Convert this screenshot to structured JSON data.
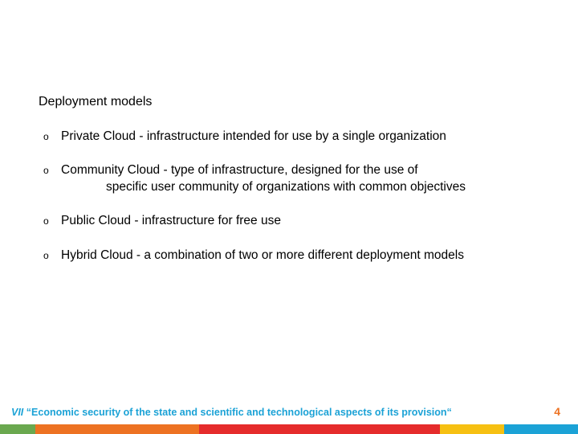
{
  "heading": "Deployment models",
  "bullets": [
    {
      "line1": "Private Cloud - infrastructure intended for use by a single organization",
      "line2": ""
    },
    {
      "line1": "Community Cloud - type of infrastructure, designed for the use of",
      "line2": "specific user community of organizations with common objectives"
    },
    {
      "line1": "Public Cloud - infrastructure for free use",
      "line2": ""
    },
    {
      "line1": "Hybrid Cloud - a combination of two or more different deployment models",
      "line2": ""
    }
  ],
  "footer": {
    "roman": "VII",
    "text": "“Economic security of the state and scientific and technological aspects of its provision“",
    "page_number": "4",
    "stripe_colors": [
      "#6aa84f",
      "#ed7222",
      "#e52c2c",
      "#f6c012",
      "#1ba2d6"
    ]
  }
}
